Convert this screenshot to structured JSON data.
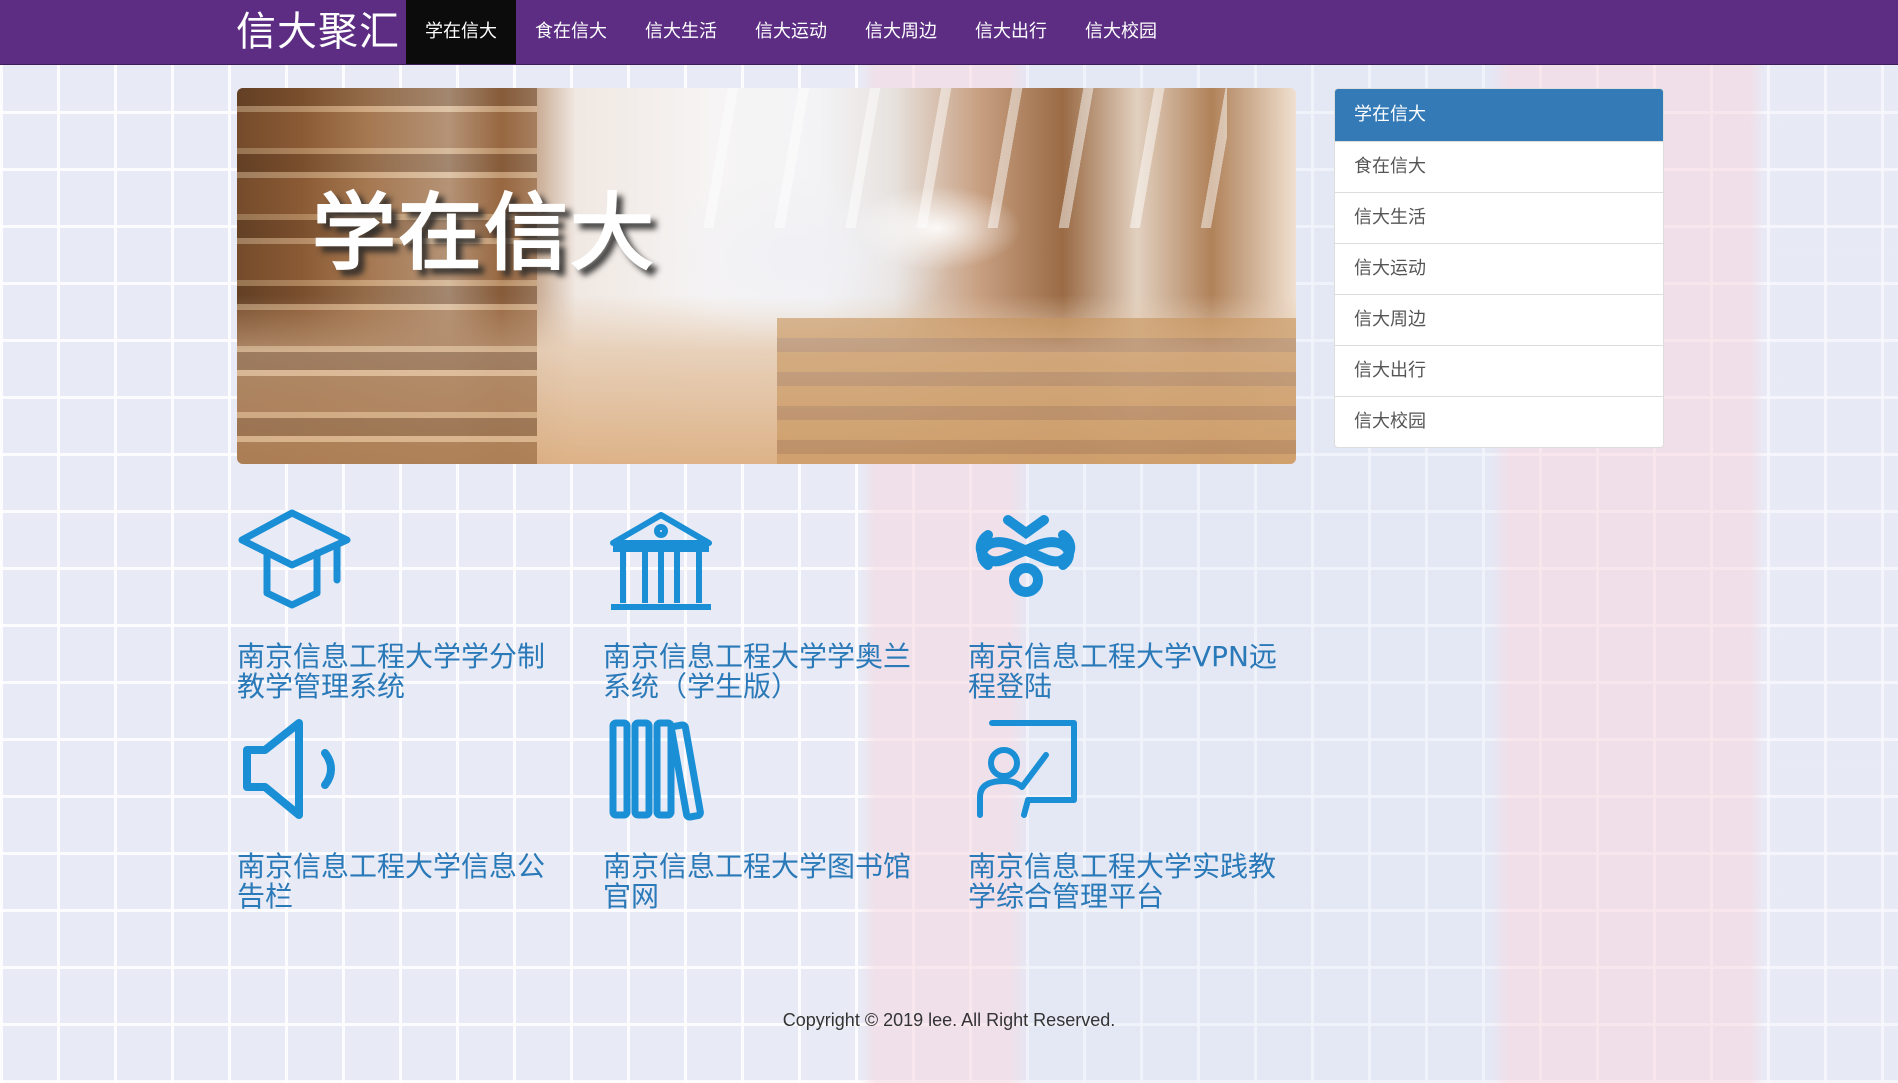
{
  "navbar": {
    "brand": "信大聚汇",
    "items": [
      "学在信大",
      "食在信大",
      "信大生活",
      "信大运动",
      "信大周边",
      "信大出行",
      "信大校园"
    ],
    "active_index": 0
  },
  "hero": {
    "title": "学在信大"
  },
  "sidebar": {
    "items": [
      "学在信大",
      "食在信大",
      "信大生活",
      "信大运动",
      "信大周边",
      "信大出行",
      "信大校园"
    ],
    "active_index": 0
  },
  "tiles": [
    {
      "icon": "graduation-cap-icon",
      "label": "南京信息工程大学学分制教学管理系统"
    },
    {
      "icon": "bank-building-icon",
      "label": "南京信息工程大学学奥兰系统（学生版）"
    },
    {
      "icon": "vpn-knot-icon",
      "label": "南京信息工程大学VPN远程登陆"
    },
    {
      "icon": "speaker-icon",
      "label": "南京信息工程大学信息公告栏"
    },
    {
      "icon": "books-icon",
      "label": "南京信息工程大学图书馆官网"
    },
    {
      "icon": "teacher-board-icon",
      "label": "南京信息工程大学实践教学综合管理平台"
    }
  ],
  "colors": {
    "navbar": "#5c2d83",
    "nav_active": "#0c0c0c",
    "sidebar_active": "#337ab7",
    "link": "#2a79b8",
    "icon": "#1a8fd6"
  },
  "footer": {
    "text": "Copyright © 2019 lee. All Right Reserved."
  }
}
